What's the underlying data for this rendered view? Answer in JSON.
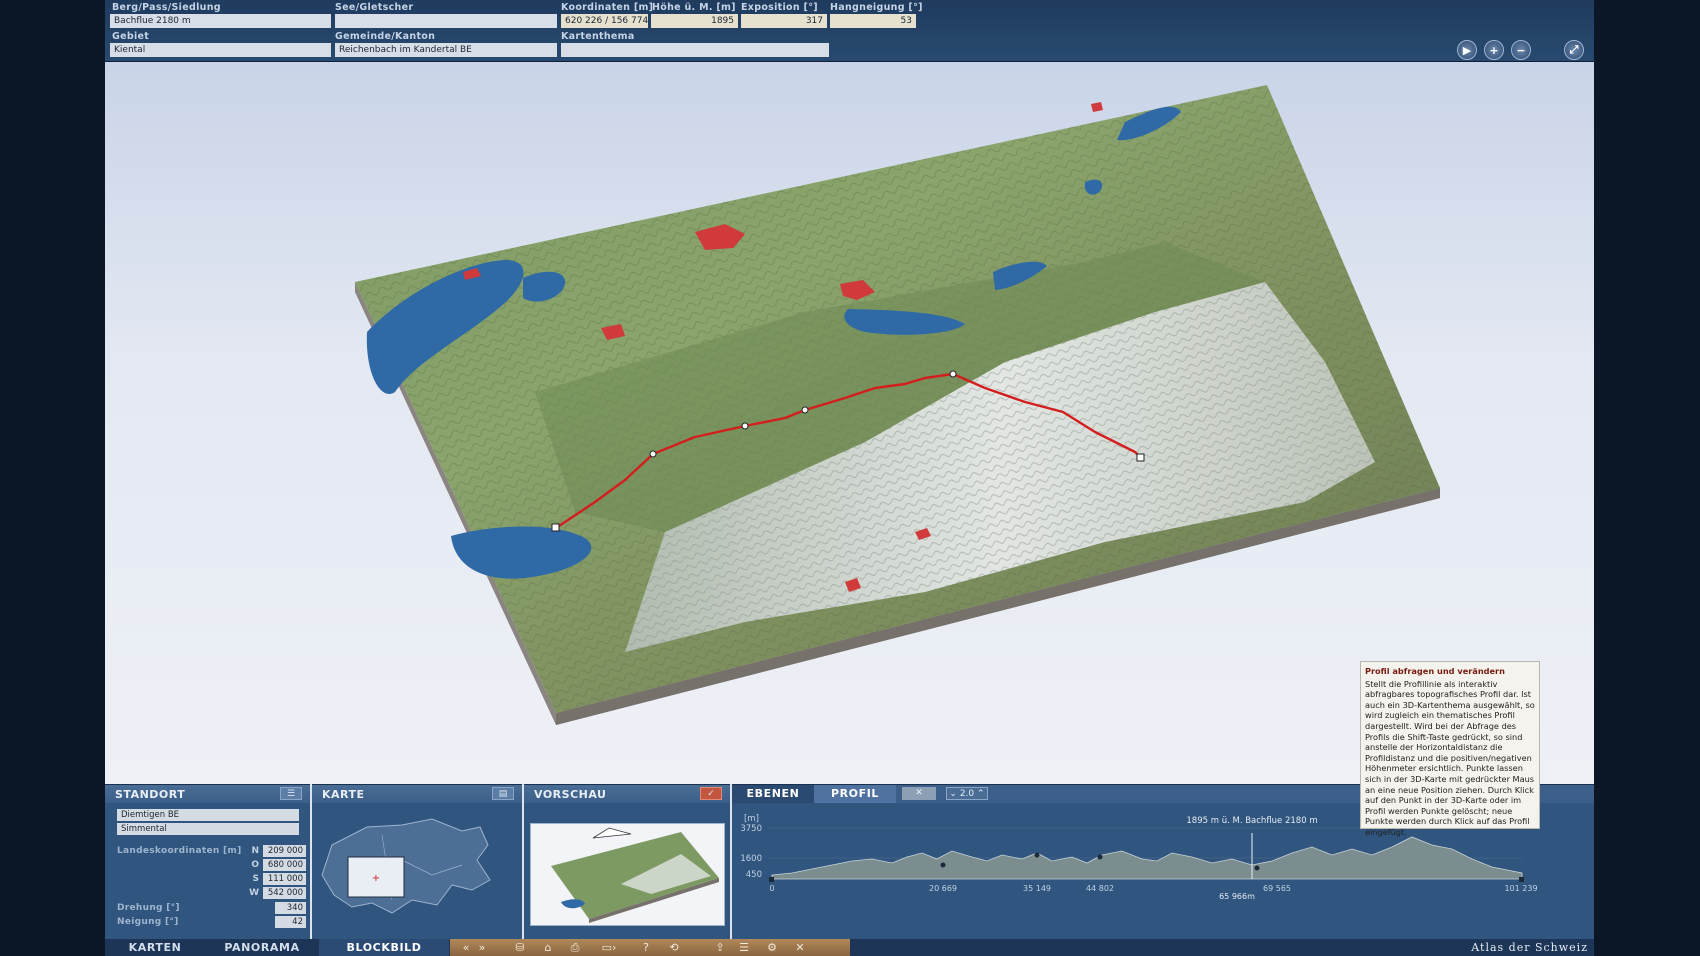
{
  "top": {
    "labels": {
      "berg": "Berg/Pass/Siedlung",
      "see": "See/Gletscher",
      "koordinaten": "Koordinaten [m]",
      "hoehe": "Höhe ü. M. [m]",
      "exposition": "Exposition [°]",
      "hangneigung": "Hangneigung [°]",
      "gebiet": "Gebiet",
      "gemeinde": "Gemeinde/Kanton",
      "kartenthema": "Kartenthema"
    },
    "values": {
      "berg": "Bachflue   2180 m",
      "see": "",
      "koordinaten": "620 226 / 156 774",
      "hoehe": "1895",
      "exposition": "317",
      "hangneigung": "53",
      "gebiet": "Kiental",
      "gemeinde": "Reichenbach im Kandertal   BE",
      "kartenthema": ""
    },
    "buttons": {
      "play": "▶",
      "zoom_in": "+",
      "zoom_out": "−",
      "fullscreen": "⤢"
    }
  },
  "tooltip": {
    "title": "Profil abfragen und verändern",
    "body": "Stellt die Profillinie als interaktiv abfragbares topografisches Profil dar. Ist auch ein 3D-Kartenthema ausgewählt, so wird zugleich ein thematisches Profil dargestellt. Wird bei der Abfrage des Profils die Shift-Taste gedrückt, so sind anstelle der Horizontaldistanz die Profildistanz und die positiven/negativen Höhenmeter ersichtlich. Punkte lassen sich in der 3D-Karte mit gedrückter Maus an eine neue Position ziehen. Durch Klick auf den Punkt in der 3D-Karte oder im Profil werden Punkte gelöscht; neue Punkte werden durch Klick auf das Profil eingefügt."
  },
  "standort": {
    "title": "STANDORT",
    "place": "Diemtigen   BE",
    "region": "Simmental",
    "coords_label": "Landeskoordinaten [m]",
    "coords": [
      {
        "dir": "N",
        "value": "209 000"
      },
      {
        "dir": "O",
        "value": "680 000"
      },
      {
        "dir": "S",
        "value": "111 000"
      },
      {
        "dir": "W",
        "value": "542 000"
      }
    ],
    "drehung_label": "Drehung [°]",
    "drehung": "340",
    "neigung_label": "Neigung [°]",
    "neigung": "42"
  },
  "karte": {
    "title": "KARTE"
  },
  "vorschau": {
    "title": "VORSCHAU",
    "check": "✓"
  },
  "ebenen": {
    "tab_ebenen": "EBENEN",
    "tab_profil": "PROFIL",
    "close": "✕",
    "exaggeration": "2.0",
    "unit": "[m]",
    "y_ticks": [
      "3750",
      "1600",
      "450"
    ],
    "x_ticks": [
      "0",
      "20 669",
      "35 149",
      "44 802",
      "65 966m",
      "69 565",
      "101 239"
    ],
    "cursor_readout": "1895 m ü. M.  Bachflue   2180 m"
  },
  "tabs": {
    "karten": "KARTEN",
    "panorama": "PANORAMA",
    "blockbild": "BLOCKBILD"
  },
  "tools": [
    "«",
    "»",
    "⛁",
    "⌂",
    "⎙",
    "▭›",
    "?",
    "⟲",
    "⇪",
    "☰",
    "⚙",
    "✕"
  ],
  "brand": "Atlas der Schweiz",
  "colors": {
    "route": "#d41e1e",
    "panel": "#30557e",
    "topbar": "#254669",
    "toolstrip": "#a17a4e"
  }
}
